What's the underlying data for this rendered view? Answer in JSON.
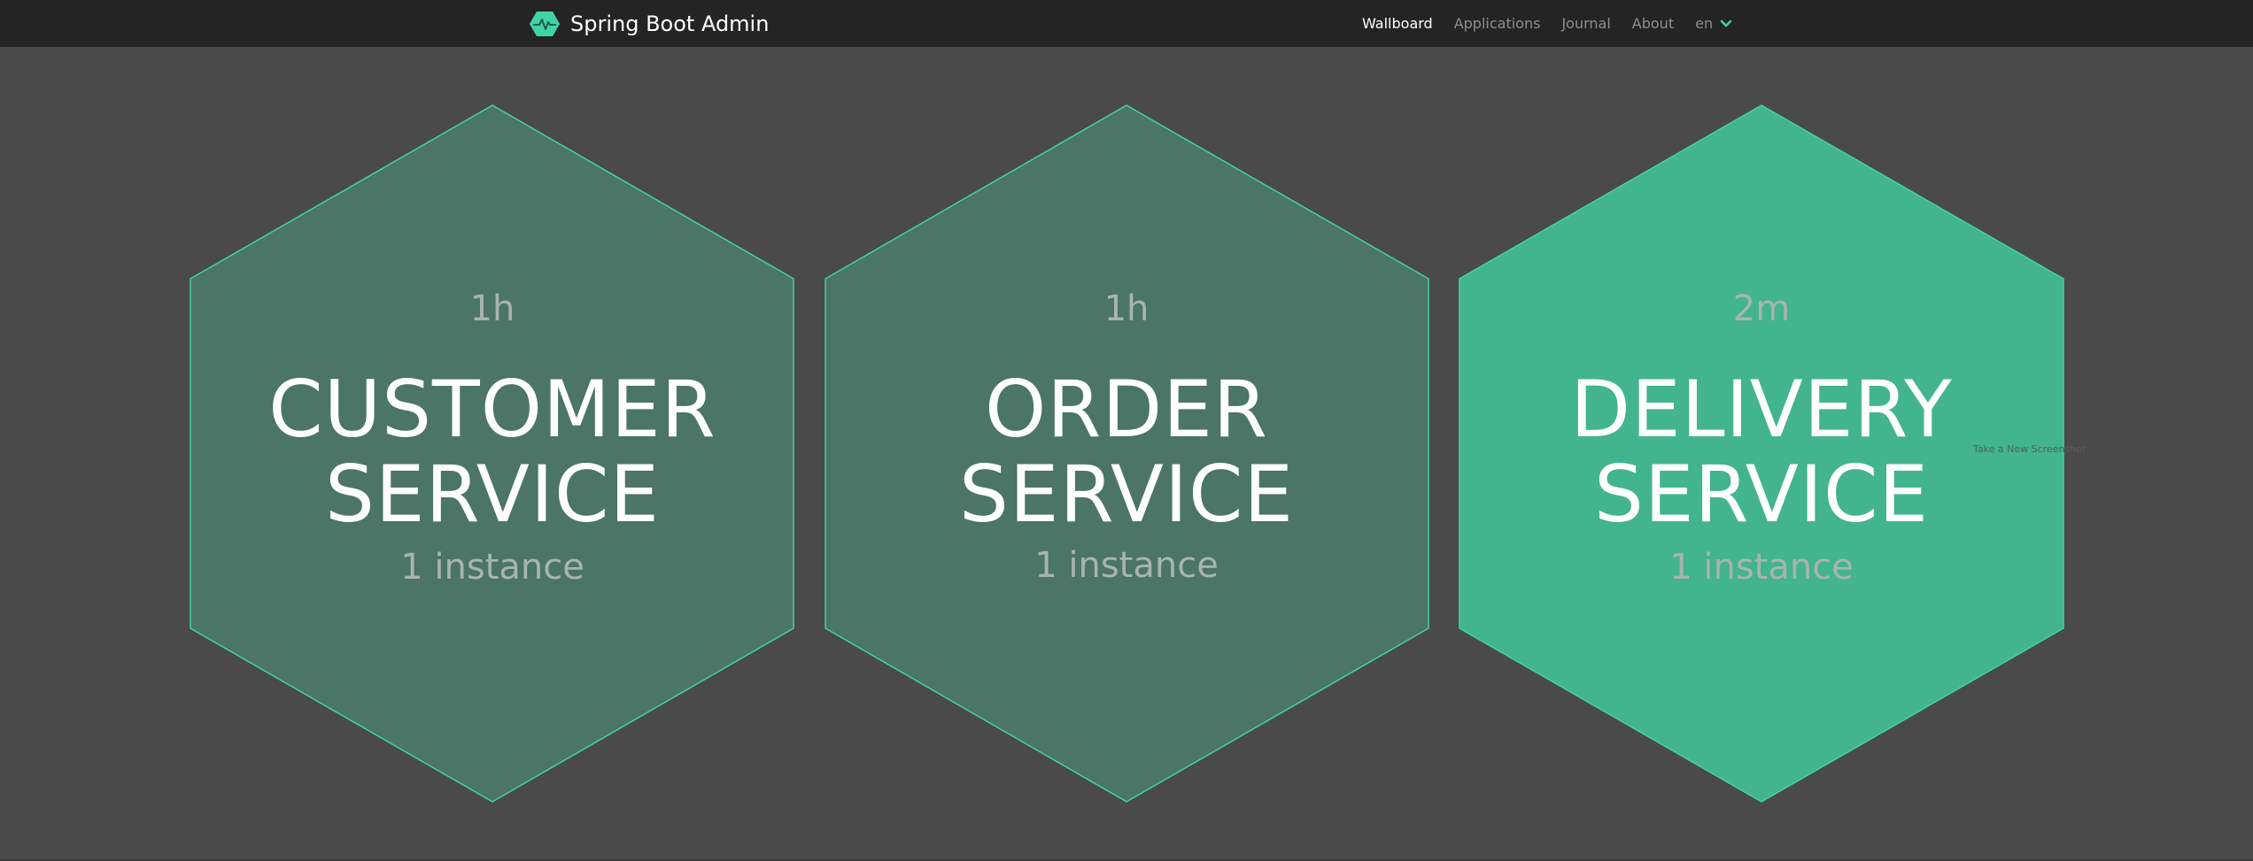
{
  "navbar": {
    "brand": "Spring Boot Admin",
    "items": [
      {
        "label": "Wallboard",
        "active": true
      },
      {
        "label": "Applications",
        "active": false
      },
      {
        "label": "Journal",
        "active": false
      },
      {
        "label": "About",
        "active": false
      }
    ],
    "language": "en"
  },
  "wallboard": {
    "applications": [
      {
        "uptime": "1h",
        "name_line1": "CUSTOMER",
        "name_line2": "SERVICE",
        "instances": "1 instance",
        "status": "up"
      },
      {
        "uptime": "1h",
        "name_line1": "ORDER",
        "name_line2": "SERVICE",
        "instances": "1 instance",
        "status": "up"
      },
      {
        "uptime": "2m",
        "name_line1": "DELIVERY",
        "name_line2": "SERVICE",
        "instances": "1 instance",
        "status": "up-highlighted"
      }
    ]
  },
  "overlay": {
    "hint": "Take a New Screenshot"
  },
  "colors": {
    "navbar_bg": "#242424",
    "page_bg": "#4a4a4a",
    "hex_dim_fill": "#4a7567",
    "hex_bright_fill": "#42b48e",
    "hex_stroke": "#42d3a5",
    "accent": "#42d3a5"
  }
}
